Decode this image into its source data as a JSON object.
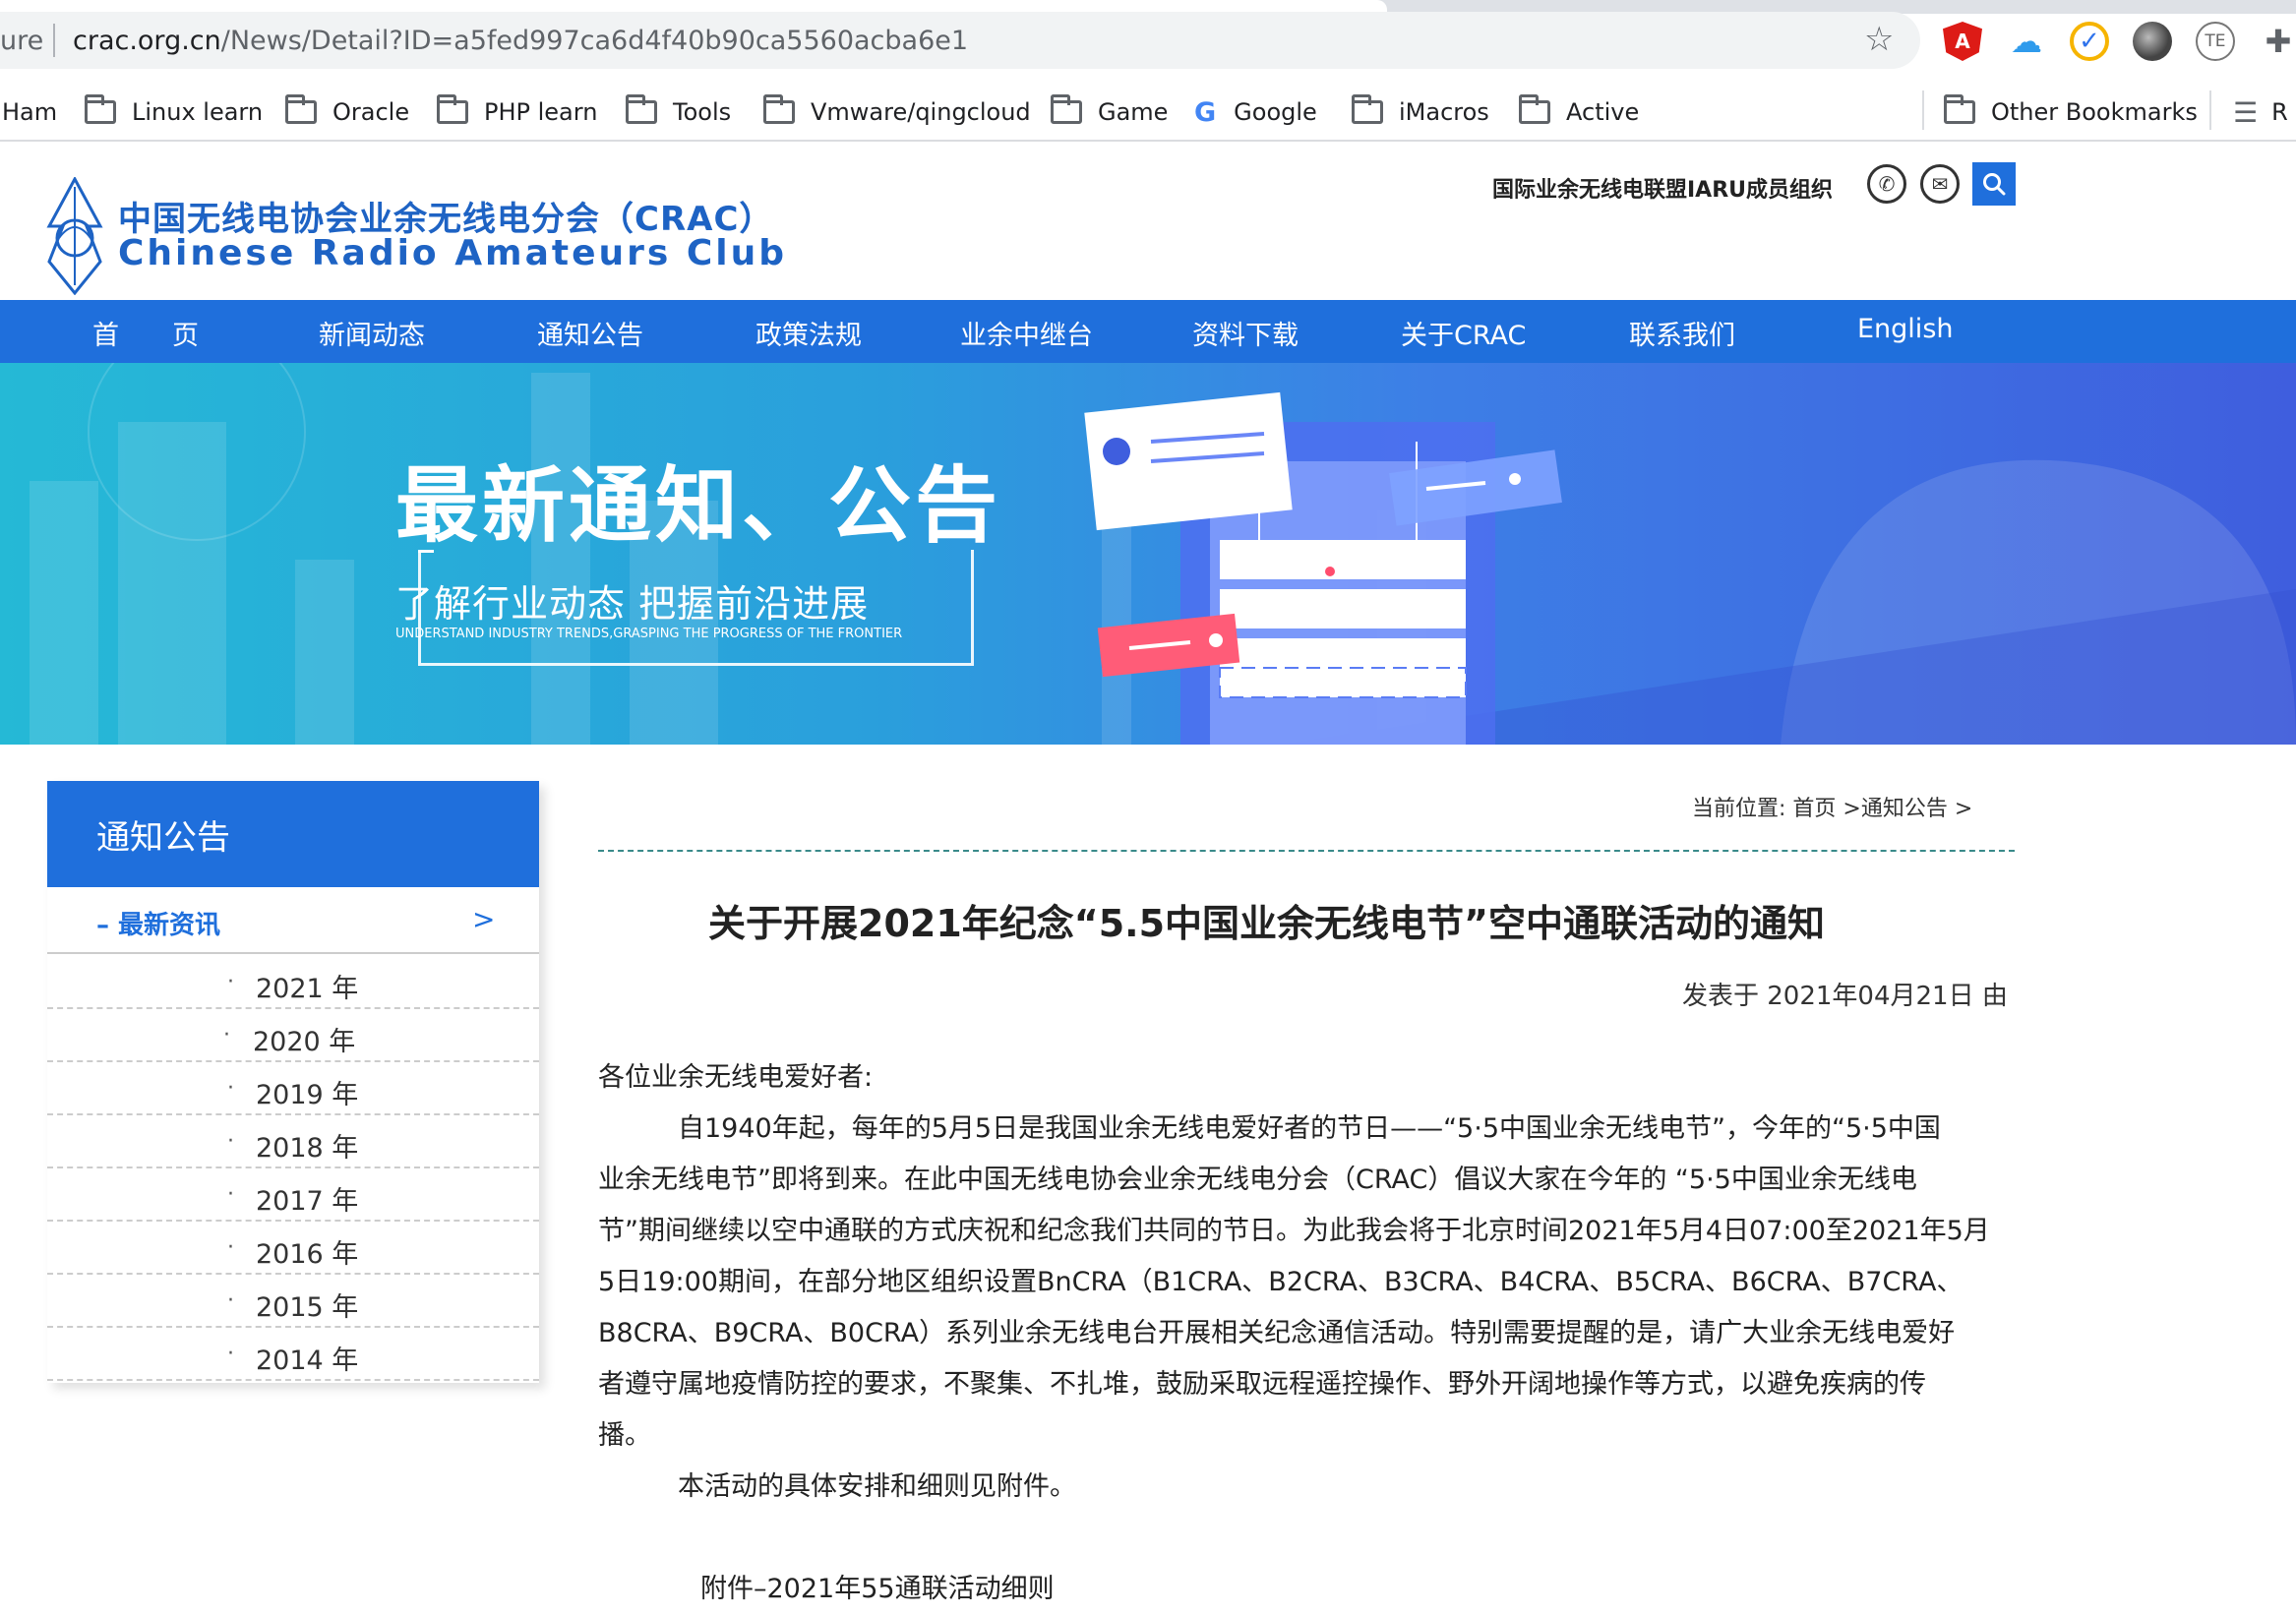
{
  "browser": {
    "url_scheme": "ure",
    "url_host": "crac.org.cn",
    "url_path": "/News/Detail?ID=a5fed997ca6d4f40b90ca5560acba6e1",
    "extensions": {
      "te_label": "TE"
    }
  },
  "bookmarks": {
    "items": [
      "Ham",
      "Linux learn",
      "Oracle",
      "PHP learn",
      "Tools",
      "Vmware/qingcloud",
      "Game",
      "Google",
      "iMacros",
      "Active"
    ],
    "other": "Other Bookmarks",
    "reading": "R"
  },
  "site": {
    "logo_cn": "中国无线电协会业余无线电分会（CRAC）",
    "logo_en": "Chinese Radio Amateurs Club",
    "iaru": "国际业余无线电联盟IARU成员组织"
  },
  "nav": [
    "首　　页",
    "新闻动态",
    "通知公告",
    "政策法规",
    "业余中继台",
    "资料下载",
    "关于CRAC",
    "联系我们",
    "English"
  ],
  "banner": {
    "title": "最新通知、公告",
    "subtitle": "了解行业动态  把握前沿进展",
    "subtitle_en": "UNDERSTAND INDUSTRY TRENDS,GRASPING THE PROGRESS OF THE FRONTIER"
  },
  "sidebar": {
    "title": "通知公告",
    "active": "– 最新资讯",
    "active_arrow": ">",
    "years": [
      "2021  年",
      "2020  年",
      "2019  年",
      "2018  年",
      "2017  年",
      "2016  年",
      "2015  年",
      "2014  年"
    ]
  },
  "article": {
    "breadcrumb": "当前位置:  首页 >通知公告 >",
    "title": "关于开展2021年纪念“5.5中国业余无线电节”空中通联活动的通知",
    "meta": "发表于 2021年04月21日 由",
    "greeting": "各位业余无线电爱好者:",
    "body_lines": [
      "　　　自1940年起，每年的5月5日是我国业余无线电爱好者的节日——“5·5中国业余无线电节”，今年的“5·5中国",
      "业余无线电节”即将到来。在此中国无线电协会业余无线电分会（CRAC）倡议大家在今年的 “5·5中国业余无线电",
      "节”期间继续以空中通联的方式庆祝和纪念我们共同的节日。为此我会将于北京时间2021年5月4日07:00至2021年5月",
      "5日19:00期间，在部分地区组织设置BnCRA（B1CRA、B2CRA、B3CRA、B4CRA、B5CRA、B6CRA、B7CRA、",
      "B8CRA、B9CRA、B0CRA）系列业余无线电台开展相关纪念通信活动。特别需要提醒的是，请广大业余无线电爱好",
      "者遵守属地疫情防控的要求，不聚集、不扎堆，鼓励采取远程遥控操作、野外开阔地操作等方式，以避免疾病的传",
      "播。"
    ],
    "closing": "　　　本活动的具体安排和细则见附件。",
    "attachment": "附件–2021年55通联活动细则"
  }
}
